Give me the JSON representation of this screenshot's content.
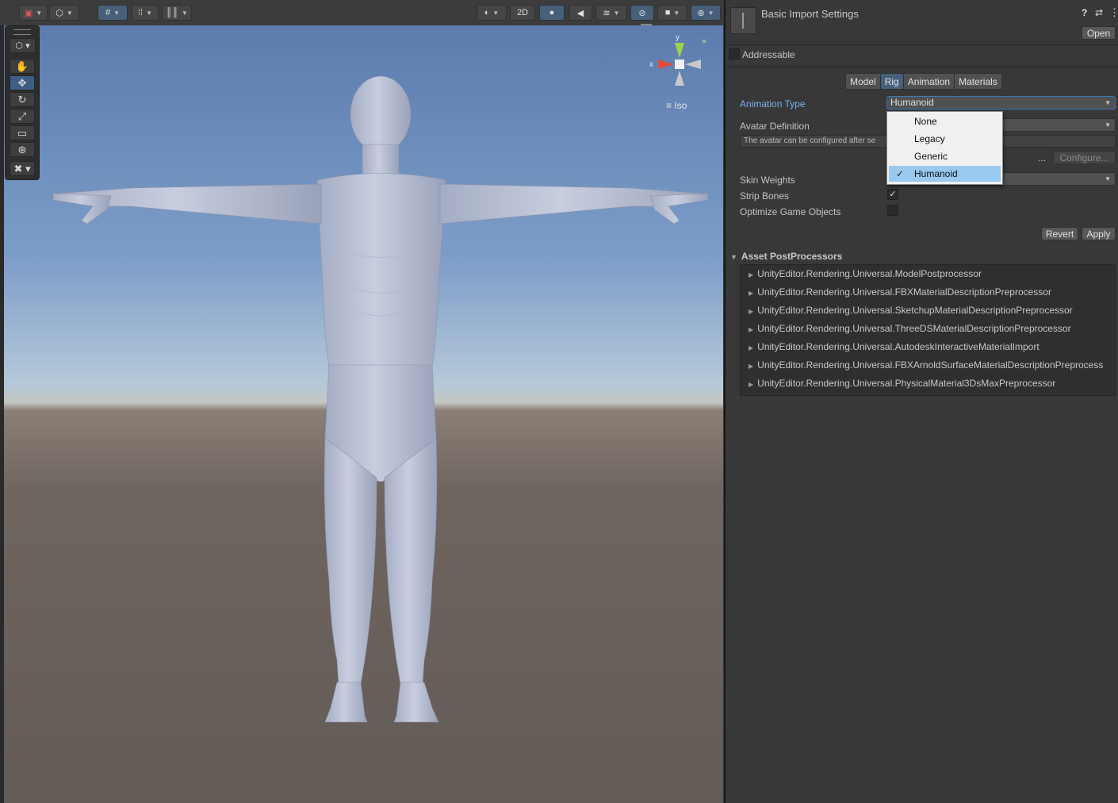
{
  "scene": {
    "toolbar": {
      "mode_2d": "2D"
    },
    "gizmo": {
      "axis_y": "y",
      "axis_x": "x",
      "projection": "Iso"
    }
  },
  "inspector": {
    "header_title": "Basic Import Settings",
    "open_button": "Open",
    "addressable_label": "Addressable",
    "tabs": [
      "Model",
      "Rig",
      "Animation",
      "Materials"
    ],
    "selected_tab": "Rig",
    "animation_type_label": "Animation Type",
    "animation_type_value": "Humanoid",
    "avatar_definition_label": "Avatar Definition",
    "avatar_help_text": "The avatar can be configured after se",
    "ellipsis": "...",
    "configure_button": "Configure...",
    "skin_weights_label": "Skin Weights",
    "strip_bones_label": "Strip Bones",
    "strip_bones_checked": true,
    "optimize_label": "Optimize Game Objects",
    "optimize_checked": false,
    "revert_button": "Revert",
    "apply_button": "Apply",
    "postprocessors_header": "Asset PostProcessors",
    "postprocessors": [
      "UnityEditor.Rendering.Universal.ModelPostprocessor",
      "UnityEditor.Rendering.Universal.FBXMaterialDescriptionPreprocessor",
      "UnityEditor.Rendering.Universal.SketchupMaterialDescriptionPreprocessor",
      "UnityEditor.Rendering.Universal.ThreeDSMaterialDescriptionPreprocessor",
      "UnityEditor.Rendering.Universal.AutodeskInteractiveMaterialImport",
      "UnityEditor.Rendering.Universal.FBXArnoldSurfaceMaterialDescriptionPreprocess",
      "UnityEditor.Rendering.Universal.PhysicalMaterial3DsMaxPreprocessor"
    ]
  },
  "animation_type_popup": {
    "options": [
      "None",
      "Legacy",
      "Generic",
      "Humanoid"
    ],
    "selected": "Humanoid"
  },
  "colors": {
    "accent": "#46607c",
    "label_highlight": "#7ab1f0",
    "popup_selection": "#99c9ef"
  }
}
